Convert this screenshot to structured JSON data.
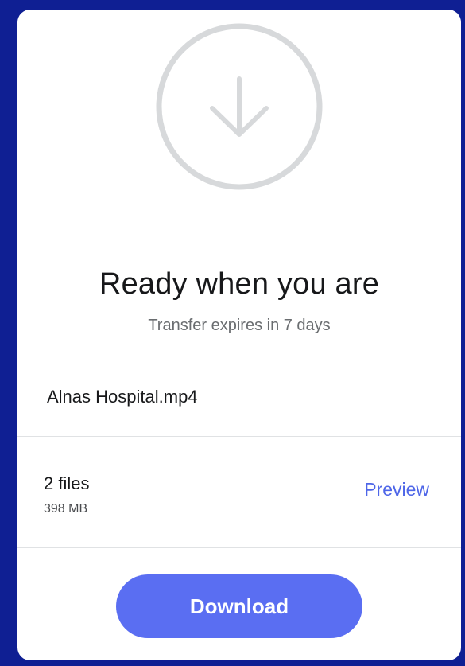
{
  "transfer": {
    "title": "Ready when you are",
    "subtitle": "Transfer expires in 7 days",
    "filename": "Alnas Hospital.mp4",
    "files_count": "2 files",
    "files_size": "398 MB",
    "preview_label": "Preview",
    "download_label": "Download"
  },
  "icons": {
    "status": "download-arrow-icon"
  },
  "colors": {
    "frame_background": "#0f1f93",
    "card_background": "#ffffff",
    "accent": "#5a6ef2",
    "link": "#4e66e8",
    "circle_outline": "#d7d9db"
  }
}
